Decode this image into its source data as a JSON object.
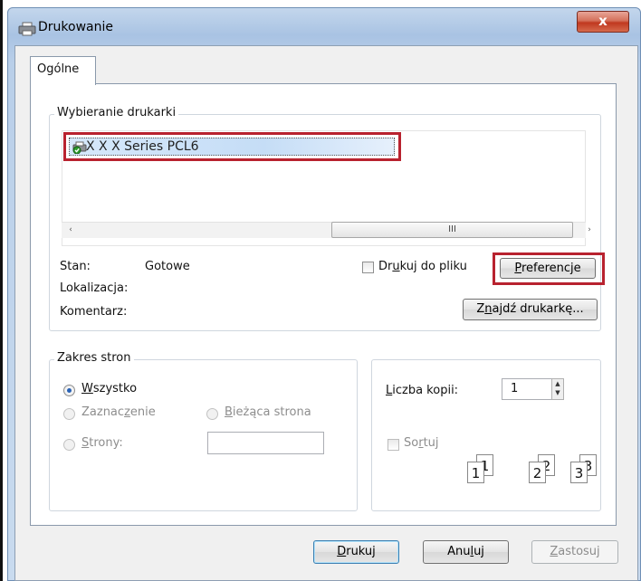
{
  "window": {
    "title": "Drukowanie",
    "close_glyph": "x"
  },
  "tabs": [
    {
      "label": "Ogólne",
      "selected": true
    }
  ],
  "printer_select": {
    "group_label": "Wybieranie drukarki",
    "printers": [
      {
        "name": "X X X Series PCL6",
        "icon": "printer-default-icon",
        "selected": true
      }
    ],
    "scrollbar": {
      "left_arrow": "‹",
      "right_arrow": "›",
      "thumb_grip": "III"
    },
    "status_label": "Stan:",
    "status_value": "Gotowe",
    "location_label": "Lokalizacja:",
    "comment_label": "Komentarz:",
    "print_to_file_pre": "Dr",
    "print_to_file_ul": "u",
    "print_to_file_post": "kuj do pliku",
    "print_to_file_checked": false,
    "preferences_ul": "P",
    "preferences_post": "referencje",
    "find_printer_pre": "Z",
    "find_printer_ul": "n",
    "find_printer_post": "ajdź drukarkę..."
  },
  "page_range": {
    "group_label": "Zakres stron",
    "all_ul": "W",
    "all_post": "szystko",
    "selection_pre": "Zaznac",
    "selection_ul": "z",
    "selection_post": "enie",
    "current_ul": "B",
    "current_post": "ieżąca strona",
    "pages_ul": "S",
    "pages_post": "trony:",
    "pages_value": "",
    "selected_option": "all"
  },
  "copies": {
    "label_ul": "L",
    "label_post": "iczba kopii:",
    "value": "1",
    "collate_pre": "So",
    "collate_ul": "r",
    "collate_post": "tuj",
    "collate_checked": false,
    "collate_pages": [
      "1",
      "1",
      "2",
      "2",
      "3",
      "3"
    ]
  },
  "buttons": {
    "print_ul": "D",
    "print_post": "rukuj",
    "cancel_pre": "Anu",
    "cancel_ul": "l",
    "cancel_post": "uj",
    "apply_ul": "Z",
    "apply_post": "astosuj"
  },
  "colors": {
    "highlight_border": "#b8222f",
    "title_bar": "#a9c3e3",
    "close_button": "#c0381f",
    "selection": "#c5ddf6"
  }
}
